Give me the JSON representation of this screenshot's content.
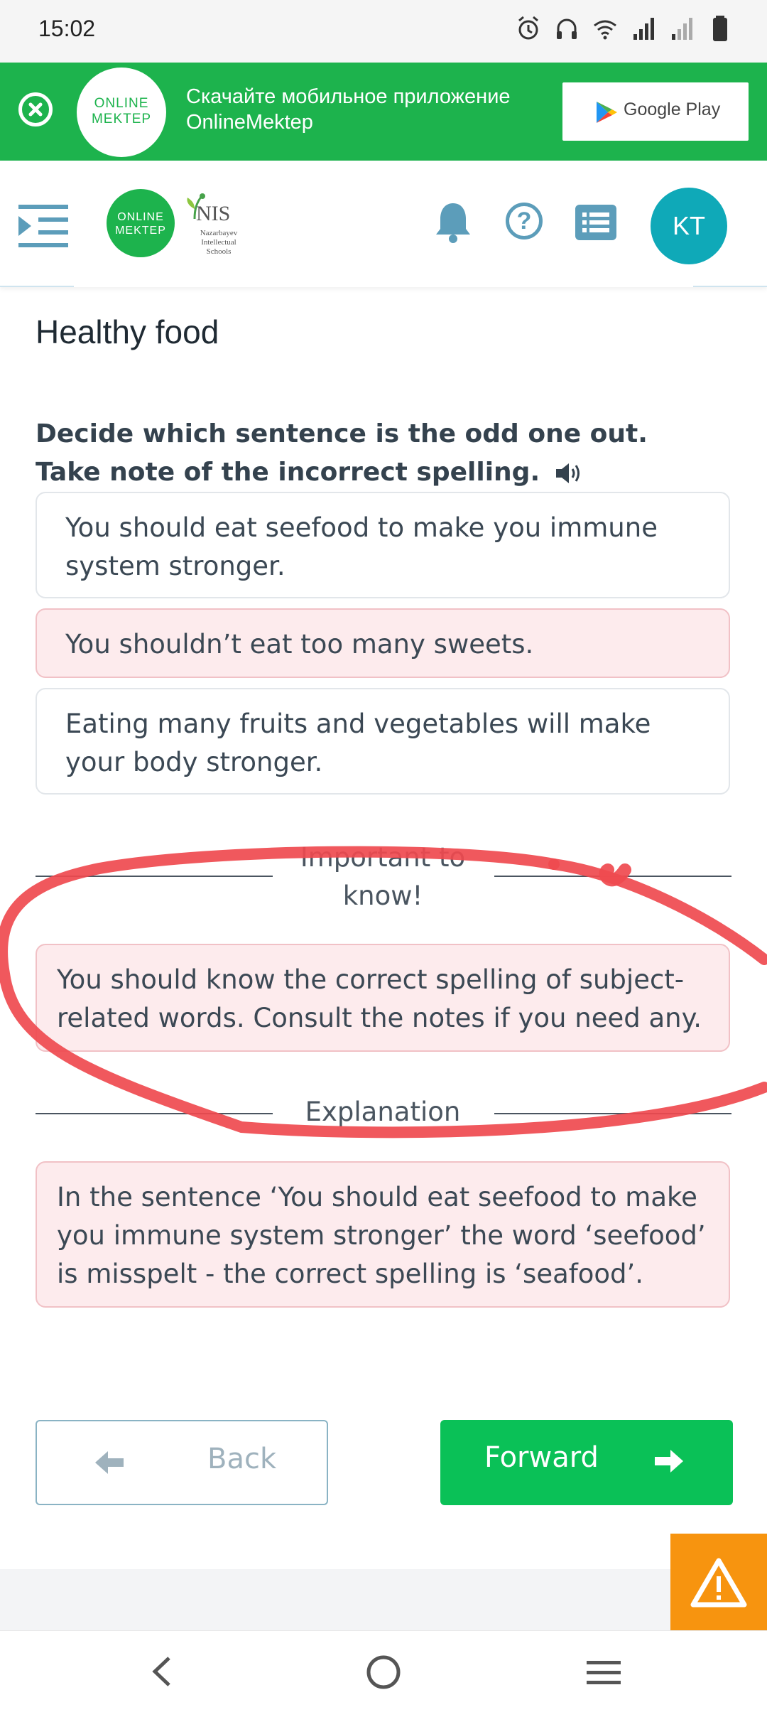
{
  "status_bar": {
    "time": "15:02"
  },
  "banner": {
    "logo_line1": "ONLINE",
    "logo_line2": "MEKTEP",
    "text_line1": "Скачайте мобильное приложение",
    "text_line2": "OnlineMektep",
    "store_label": "Google Play"
  },
  "header": {
    "logo_line1": "ONLINE",
    "logo_line2": "MEKTEP",
    "nis_name": "NIS",
    "nis_sub1": "Nazarbayev",
    "nis_sub2": "Intellectual",
    "nis_sub3": "Schools",
    "help_symbol": "?",
    "avatar_initials": "KT"
  },
  "content": {
    "page_title": "Healthy food",
    "instruction": "Decide which sentence is the odd one out. Take note of the incorrect spelling.",
    "options": [
      {
        "text": "You should eat seefood to make you immune system stronger.",
        "selected": false
      },
      {
        "text": "You shouldn’t eat too many sweets.",
        "selected": true
      },
      {
        "text": "Eating many fruits and vegetables will make your body stronger.",
        "selected": false
      }
    ],
    "important_label": "Important to know!",
    "important_text": "You should know the correct spelling of subject-related words. Consult the notes if you need any.",
    "explanation_label": "Explanation",
    "explanation_text": "In the sentence ‘You should eat seefood to make you immune system stronger’ the word ‘seefood’ is misspelt - the correct spelling is ‘seafood’."
  },
  "navigation": {
    "back_label": "Back",
    "forward_label": "Forward"
  },
  "colors": {
    "brand_green": "#1db34d",
    "forward_green": "#0ac157",
    "accent_blue": "#5c9dba",
    "avatar_teal": "#0fa9b8",
    "warning_orange": "#f7940f",
    "selected_pink": "#fdebed",
    "annotation_red": "#ef4a4f"
  }
}
